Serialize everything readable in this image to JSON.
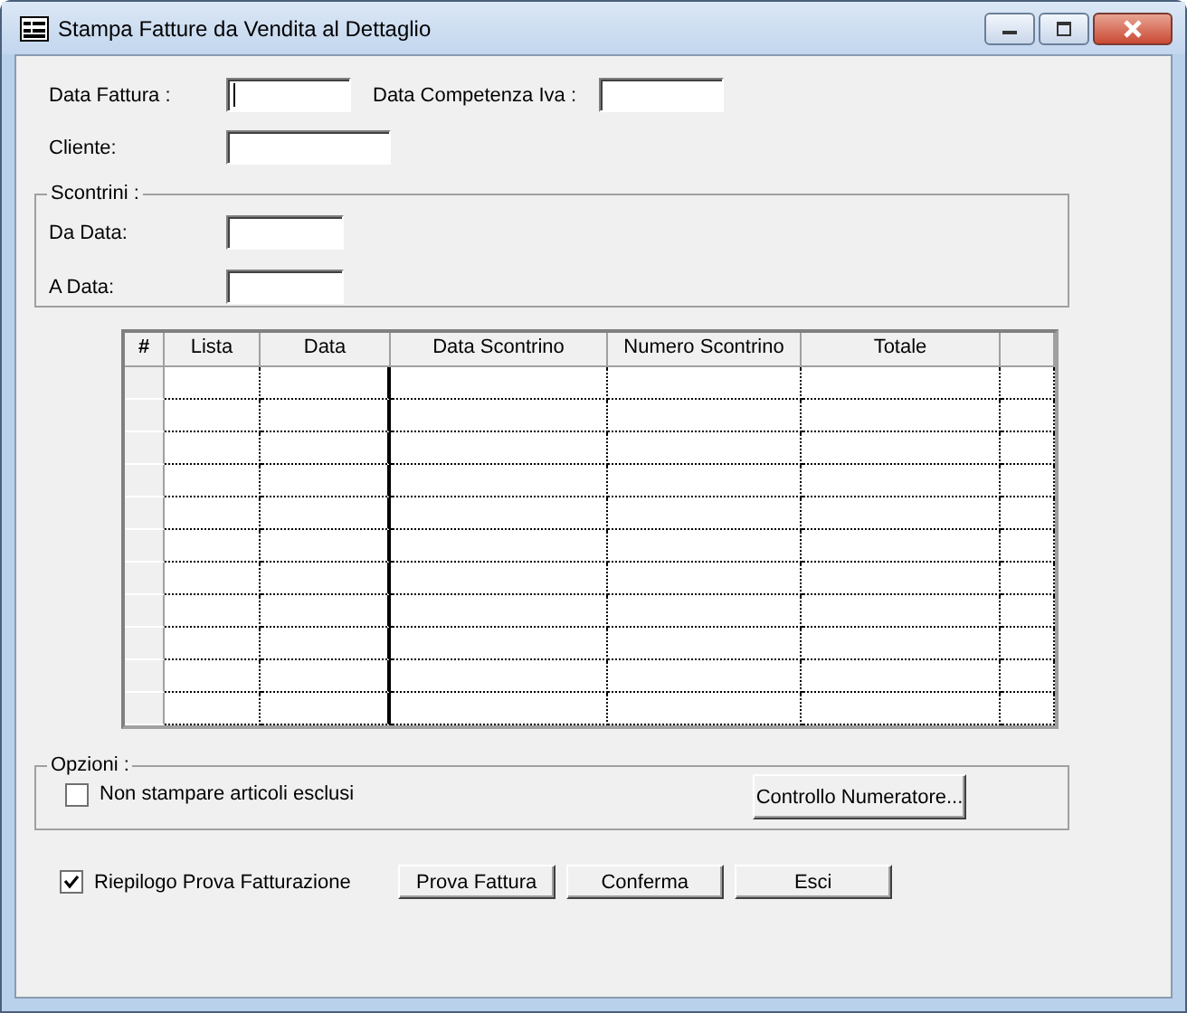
{
  "window": {
    "title": "Stampa Fatture da Vendita al Dettaglio"
  },
  "fields": [
    {
      "label": "Data Fattura :",
      "focused": true
    },
    {
      "label": "Data Competenza Iva :"
    },
    {
      "label": "Cliente:"
    }
  ],
  "scontrini": {
    "title": "Scontrini :",
    "fields": [
      {
        "label": "Da Data:"
      },
      {
        "label": "A Data:"
      }
    ]
  },
  "table": {
    "columns": [
      "#",
      "Lista",
      "Data",
      "Data Scontrino",
      "Numero Scontrino",
      "Totale"
    ]
  },
  "options": {
    "title": "Opzioni :",
    "checkbox": {
      "label": "Non stampare articoli esclusi",
      "checked": false
    },
    "button": "Controllo Numeratore..."
  },
  "footer": {
    "checkbox": {
      "label": "Riepilogo Prova Fatturazione",
      "checked": true
    },
    "buttons": [
      "Prova Fattura",
      "Conferma",
      "Esci"
    ]
  }
}
